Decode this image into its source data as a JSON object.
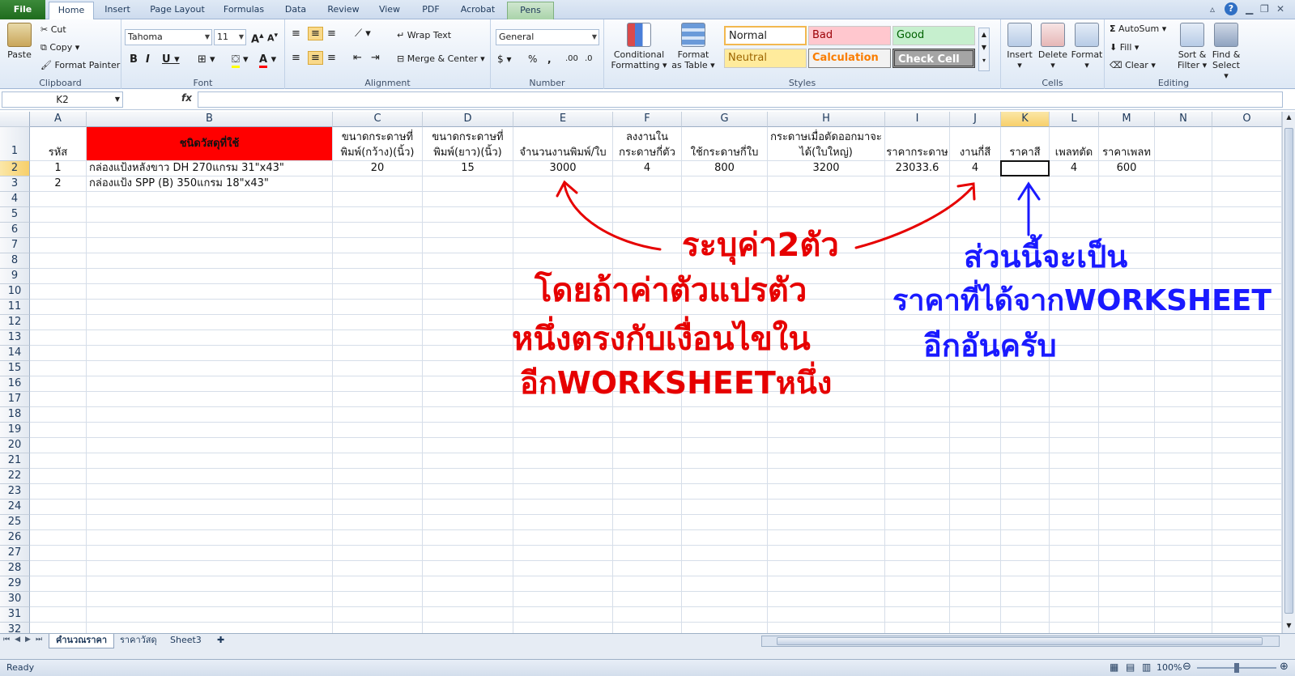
{
  "tabs": [
    "File",
    "Home",
    "Insert",
    "Page Layout",
    "Formulas",
    "Data",
    "Review",
    "View",
    "PDF",
    "Acrobat",
    "Pens"
  ],
  "clipboard": {
    "paste": "Paste",
    "cut": "Cut",
    "copy": "Copy",
    "painter": "Format Painter",
    "label": "Clipboard"
  },
  "font": {
    "name": "Tahoma",
    "size": "11",
    "label": "Font"
  },
  "alignment": {
    "wrap": "Wrap Text",
    "merge": "Merge & Center",
    "label": "Alignment"
  },
  "number": {
    "format": "General",
    "label": "Number"
  },
  "styles": {
    "normal": "Normal",
    "bad": "Bad",
    "good": "Good",
    "neutral": "Neutral",
    "calculation": "Calculation",
    "check": "Check Cell",
    "cond1": "Conditional",
    "cond2": "Formatting",
    "fmt1": "Format",
    "fmt2": "as Table",
    "label": "Styles"
  },
  "cells": {
    "insert": "Insert",
    "delete": "Delete",
    "format": "Format",
    "label": "Cells"
  },
  "editing": {
    "autosum": "AutoSum",
    "fill": "Fill",
    "clear": "Clear",
    "sort1": "Sort &",
    "sort2": "Filter",
    "find1": "Find &",
    "find2": "Select",
    "label": "Editing"
  },
  "formula_bar": {
    "namebox": "K2",
    "fx": "fx",
    "value": ""
  },
  "columns": [
    "A",
    "B",
    "C",
    "D",
    "E",
    "F",
    "G",
    "H",
    "I",
    "J",
    "K",
    "L",
    "M",
    "N",
    "O"
  ],
  "rows": [
    "1",
    "2",
    "3",
    "4",
    "5",
    "6",
    "7",
    "8",
    "9",
    "10",
    "11",
    "12",
    "13",
    "14",
    "15",
    "16",
    "17",
    "18",
    "19",
    "20",
    "21",
    "22",
    "23",
    "24",
    "25",
    "26",
    "27",
    "28",
    "29",
    "30",
    "31",
    "32"
  ],
  "header_row": {
    "A": "รหัส",
    "B": "ชนิดวัสดุที่ใช้",
    "C": "ขนาดกระดาษที่พิมพ์(กว้าง)(นิ้ว)",
    "D": "ขนาดกระดาษที่พิมพ์(ยาว)(นิ้ว)",
    "E": "จำนวนงานพิมพ์/ใบ",
    "F": "ลงงานในกระดาษกี่ตัว",
    "G": "ใช้กระดาษกี่ใบ",
    "H": "กระดาษเมื่อตัดออกมาจะได้(ใบใหญ่)",
    "I": "ราคากระดาษ",
    "J": "งานกี่สี",
    "K": "ราคาสี",
    "L": "เพลทตัด",
    "M": "ราคาเพลท"
  },
  "row2": {
    "A": "1",
    "B": "กล่องแป้งหลังขาว DH 270แกรม 31\"x43\"",
    "C": "20",
    "D": "15",
    "E": "3000",
    "F": "4",
    "G": "800",
    "H": "3200",
    "I": "23033.6",
    "J": "4",
    "K": "",
    "L": "4",
    "M": "600"
  },
  "row3": {
    "A": "2",
    "B": "กล่องแป้ง SPP (B) 350แกรม 18\"x43\""
  },
  "sheets": [
    "คำนวณราคา",
    "ราคาวัสดุ",
    "Sheet3"
  ],
  "status": {
    "ready": "Ready",
    "zoom": "100%"
  },
  "annotations": {
    "red1": "ระบุค่า2ตัว",
    "red2": "โดยถ้าค่าตัวแปรตัว",
    "red3": "หนึ่งตรงกับเงื่อนไขใน",
    "red4": "อีกWORKSHEETหนึ่ง",
    "blue1": "ส่วนนี้จะเป็น",
    "blue2": "ราคาที่ได้จากWORKSHEET",
    "blue3": "อีกอันครับ",
    "red_color": "#e60000",
    "blue_color": "#1a1aff"
  },
  "colors": {
    "header_fill_B": "#ff0000",
    "accent": "#1e395b"
  }
}
